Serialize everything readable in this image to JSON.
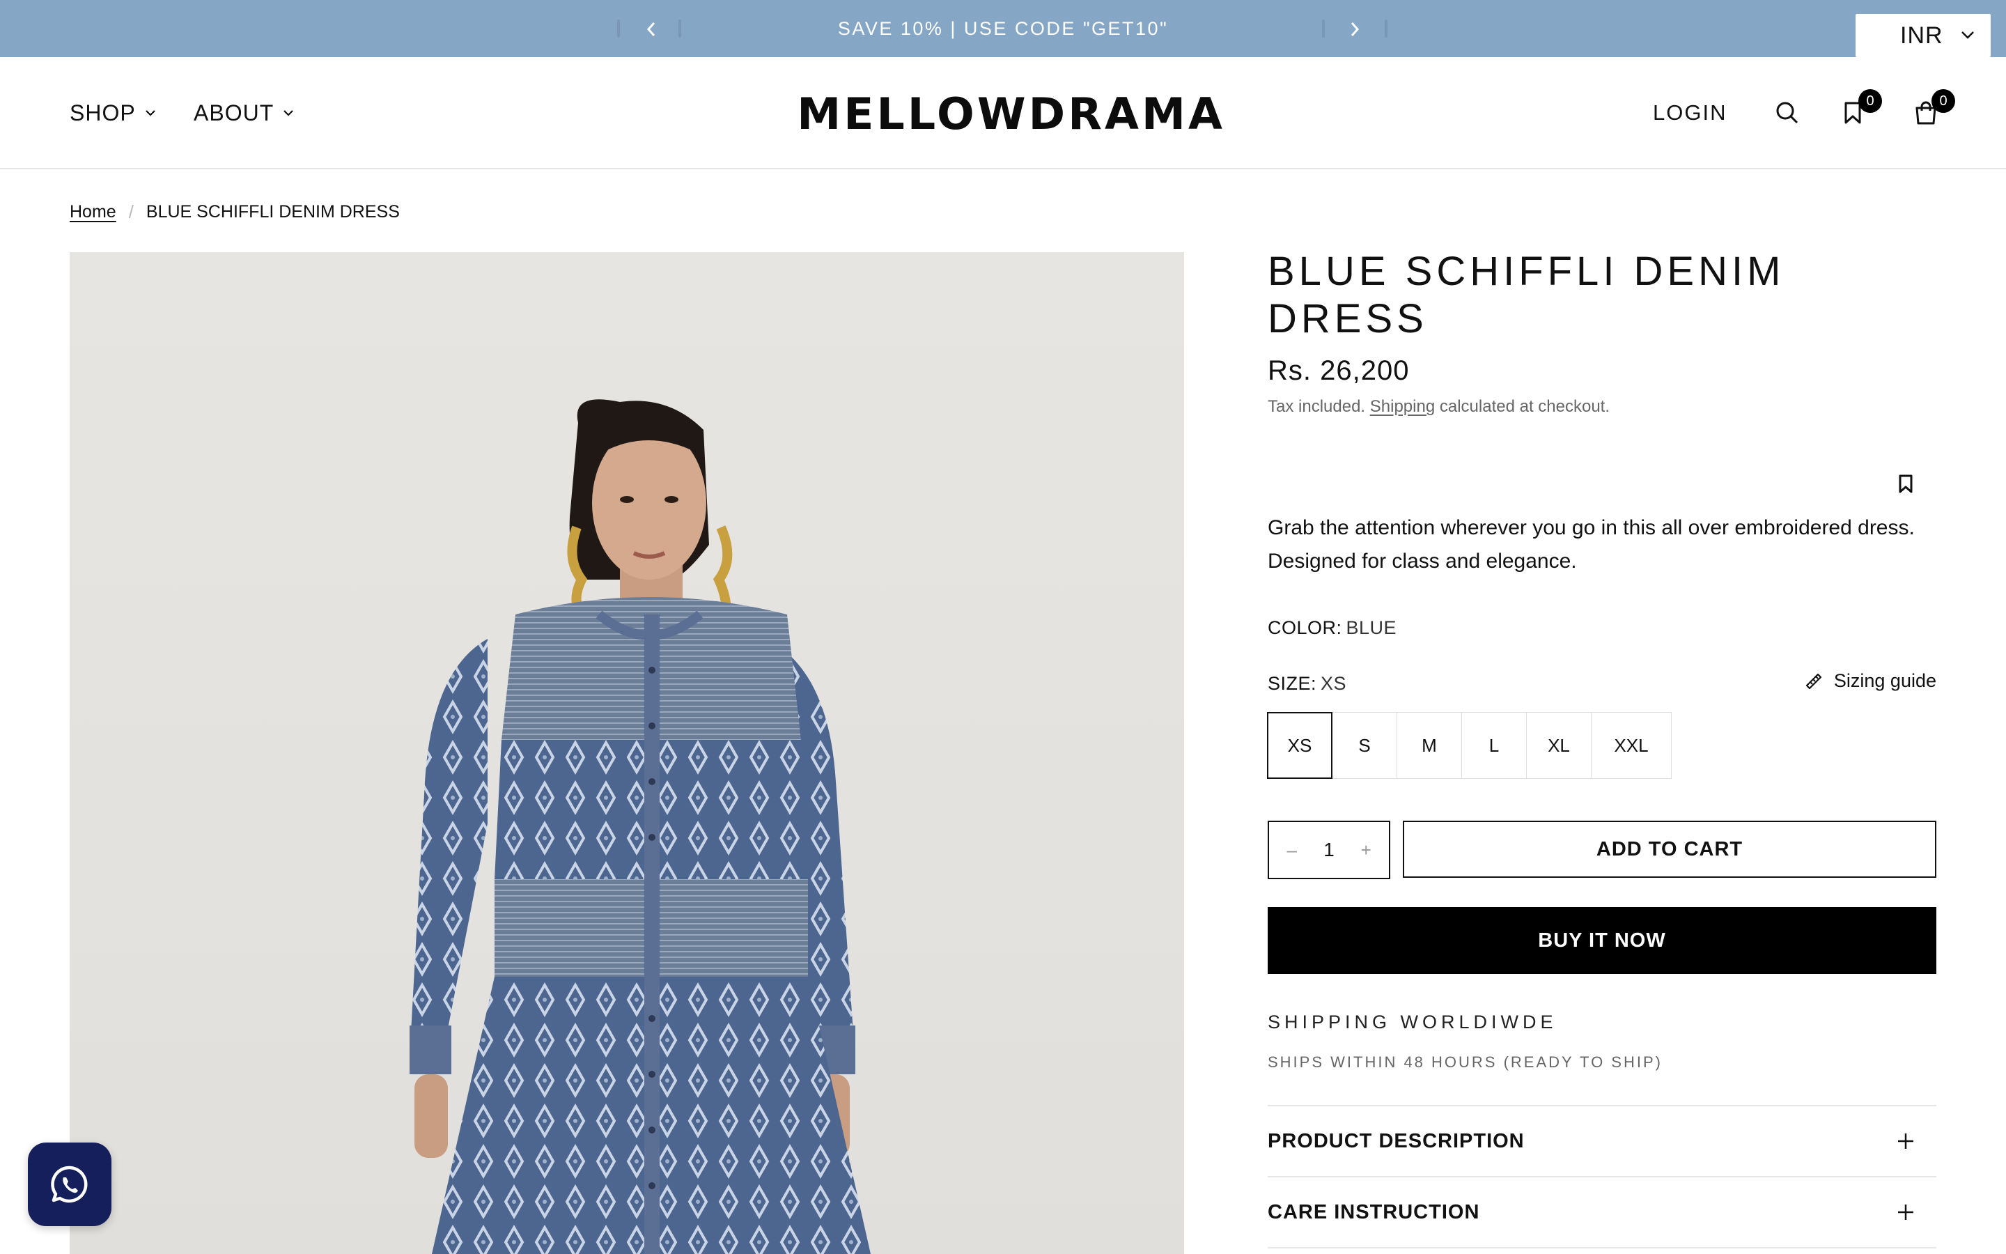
{
  "announcement": {
    "message": "SAVE 10% | USE CODE \"GET10\""
  },
  "currency": {
    "code": "INR"
  },
  "nav": {
    "shop_label": "SHOP",
    "about_label": "ABOUT",
    "login_label": "LOGIN",
    "wishlist_count": "0",
    "cart_count": "0"
  },
  "brand": {
    "logo_text": "MELLOWDRAMA"
  },
  "breadcrumb": {
    "home": "Home",
    "separator": "/",
    "current": "BLUE SCHIFFLI DENIM DRESS"
  },
  "product": {
    "title": "BLUE SCHIFFLI DENIM DRESS",
    "price": "Rs. 26,200",
    "tax_prefix": "Tax included.",
    "tax_link": "Shipping",
    "tax_suffix": "calculated at checkout.",
    "description": "Grab the attention wherever you go in this all over embroidered dress. Designed for class and elegance.",
    "color_label": "COLOR:",
    "color_value": "BLUE",
    "size_label": "SIZE:",
    "size_value": "XS",
    "sizing_guide": "Sizing guide",
    "sizes": [
      "XS",
      "S",
      "M",
      "L",
      "XL",
      "XXL"
    ],
    "selected_size": "XS",
    "quantity": "1",
    "qty_minus": "–",
    "qty_plus": "+",
    "add_to_cart": "ADD TO CART",
    "buy_now": "BUY IT NOW",
    "shipping_title": "SHIPPING WORLDIWDE",
    "shipping_sub": "SHIPS WITHIN 48 HOURS (READY TO SHIP)",
    "accordions": [
      "PRODUCT DESCRIPTION",
      "CARE INSTRUCTION"
    ]
  },
  "colors": {
    "announcement_bg": "#86a6c6",
    "whatsapp_bg": "#151f5c",
    "buy_now_bg": "#000000"
  }
}
